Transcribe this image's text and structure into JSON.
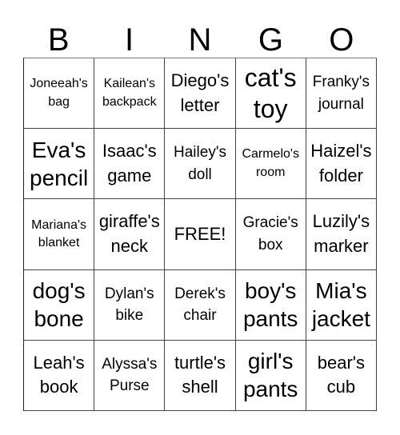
{
  "header": [
    "B",
    "I",
    "N",
    "G",
    "O"
  ],
  "cells": [
    [
      {
        "text": "Joneeah's bag",
        "size": "s"
      },
      {
        "text": "Kailean's backpack",
        "size": "s"
      },
      {
        "text": "Diego's letter",
        "size": "l"
      },
      {
        "text": "cat's toy",
        "size": "xxl"
      },
      {
        "text": "Franky's journal",
        "size": "m"
      }
    ],
    [
      {
        "text": "Eva's pencil",
        "size": "xl"
      },
      {
        "text": "Isaac's game",
        "size": "l"
      },
      {
        "text": "Hailey's doll",
        "size": "m"
      },
      {
        "text": "Carmelo's room",
        "size": "s"
      },
      {
        "text": "Haizel's folder",
        "size": "l"
      }
    ],
    [
      {
        "text": "Mariana's blanket",
        "size": "s"
      },
      {
        "text": "giraffe's neck",
        "size": "l"
      },
      {
        "text": "FREE!",
        "size": "l"
      },
      {
        "text": "Gracie's box",
        "size": "m"
      },
      {
        "text": "Luzily's marker",
        "size": "l"
      }
    ],
    [
      {
        "text": "dog's bone",
        "size": "xl"
      },
      {
        "text": "Dylan's bike",
        "size": "m"
      },
      {
        "text": "Derek's chair",
        "size": "m"
      },
      {
        "text": "boy's pants",
        "size": "xl"
      },
      {
        "text": "Mia's jacket",
        "size": "xl"
      }
    ],
    [
      {
        "text": "Leah's book",
        "size": "l"
      },
      {
        "text": "Alyssa's Purse",
        "size": "m"
      },
      {
        "text": "turtle's shell",
        "size": "l"
      },
      {
        "text": "girl's pants",
        "size": "xl"
      },
      {
        "text": "bear's cub",
        "size": "l"
      }
    ]
  ]
}
